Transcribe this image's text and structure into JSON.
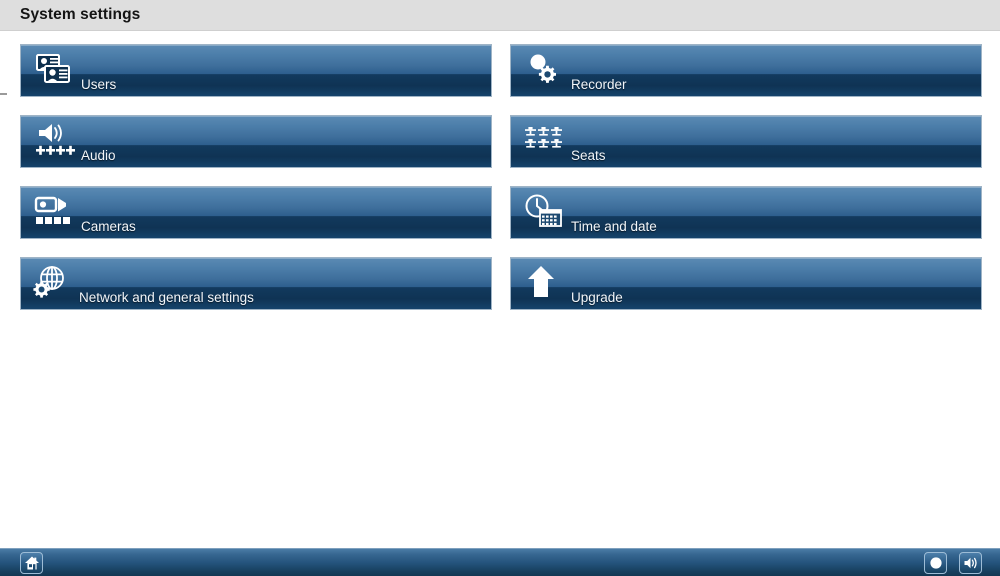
{
  "header": {
    "title": "System settings"
  },
  "tiles": [
    {
      "id": "users",
      "label": "Users",
      "icon": "id-cards-icon",
      "column": "left",
      "row": 0
    },
    {
      "id": "recorder",
      "label": "Recorder",
      "icon": "record-gear-icon",
      "column": "right",
      "row": 0
    },
    {
      "id": "audio",
      "label": "Audio",
      "icon": "speaker-mixer-icon",
      "column": "left",
      "row": 1
    },
    {
      "id": "seats",
      "label": "Seats",
      "icon": "seats-grid-icon",
      "column": "right",
      "row": 1
    },
    {
      "id": "cameras",
      "label": "Cameras",
      "icon": "video-camera-icon",
      "column": "left",
      "row": 2
    },
    {
      "id": "time",
      "label": "Time and date",
      "icon": "clock-calendar-icon",
      "column": "right",
      "row": 2
    },
    {
      "id": "network",
      "label": "Network and general settings",
      "icon": "globe-gear-icon",
      "column": "left",
      "row": 3
    },
    {
      "id": "upgrade",
      "label": "Upgrade",
      "icon": "up-arrow-icon",
      "column": "right",
      "row": 3
    }
  ],
  "taskbar": {
    "home_label": "Home",
    "record_label": "Record",
    "volume_label": "Volume"
  },
  "colors": {
    "header_bg": "#dedede",
    "tile_top": "#5b8ab3",
    "tile_bottom": "#0f3354",
    "tile_border": "#9fb4c6",
    "label_text": "#f2f6fa",
    "taskbar_top": "#4a7ba6",
    "taskbar_bottom": "#133752"
  }
}
